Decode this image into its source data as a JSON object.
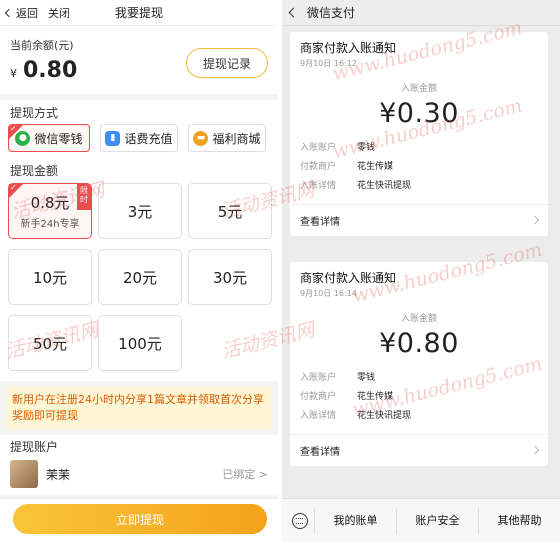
{
  "left": {
    "nav": {
      "back": "返回",
      "close": "关闭",
      "title": "我要提现"
    },
    "balance": {
      "label": "当前余额(元)",
      "currency": "¥",
      "amount": "0.80",
      "record_button": "提现记录"
    },
    "method_title": "提现方式",
    "methods": [
      {
        "label": "微信零钱",
        "icon": "wechat-icon",
        "color": "#2bb24c",
        "selected": true
      },
      {
        "label": "话费充值",
        "icon": "phone-icon",
        "color": "#3c8ef0",
        "selected": false
      },
      {
        "label": "福利商城",
        "icon": "shop-icon",
        "color": "#f0a020",
        "selected": false
      }
    ],
    "amount_title": "提现金额",
    "amounts": [
      {
        "value": "0.8元",
        "sub": "新手24h专享",
        "tag": "限时",
        "selected": true
      },
      {
        "value": "3元"
      },
      {
        "value": "5元"
      },
      {
        "value": "10元"
      },
      {
        "value": "20元"
      },
      {
        "value": "30元"
      },
      {
        "value": "50元"
      },
      {
        "value": "100元"
      }
    ],
    "notice": "新用户在注册24小时内分享1篇文章并领取首次分享奖励即可提现",
    "account_title": "提现账户",
    "account": {
      "name": "茉茉",
      "status": "已绑定 >"
    },
    "submit": "立即提现"
  },
  "right": {
    "nav": {
      "title": "微信支付"
    },
    "cards": [
      {
        "title": "商家付款入账通知",
        "date": "9月10日  16:12",
        "label": "入账金额",
        "value": "¥0.30",
        "rows": [
          {
            "k": "入账账户",
            "v": "零钱"
          },
          {
            "k": "付款商户",
            "v": "花生传媒"
          },
          {
            "k": "入账详情",
            "v": "花生快讯提现"
          }
        ],
        "more": "查看详情"
      },
      {
        "title": "商家付款入账通知",
        "date": "9月10日  16:14",
        "label": "入账金额",
        "value": "¥0.80",
        "rows": [
          {
            "k": "入账账户",
            "v": "零钱"
          },
          {
            "k": "付款商户",
            "v": "花生传媒"
          },
          {
            "k": "入账详情",
            "v": "花生快讯提现"
          }
        ],
        "more": "查看详情"
      }
    ],
    "bottom": [
      "我的账单",
      "账户安全",
      "其他帮助"
    ]
  },
  "watermark": {
    "text": "活动资讯网",
    "url": "www.huodong5.com"
  }
}
